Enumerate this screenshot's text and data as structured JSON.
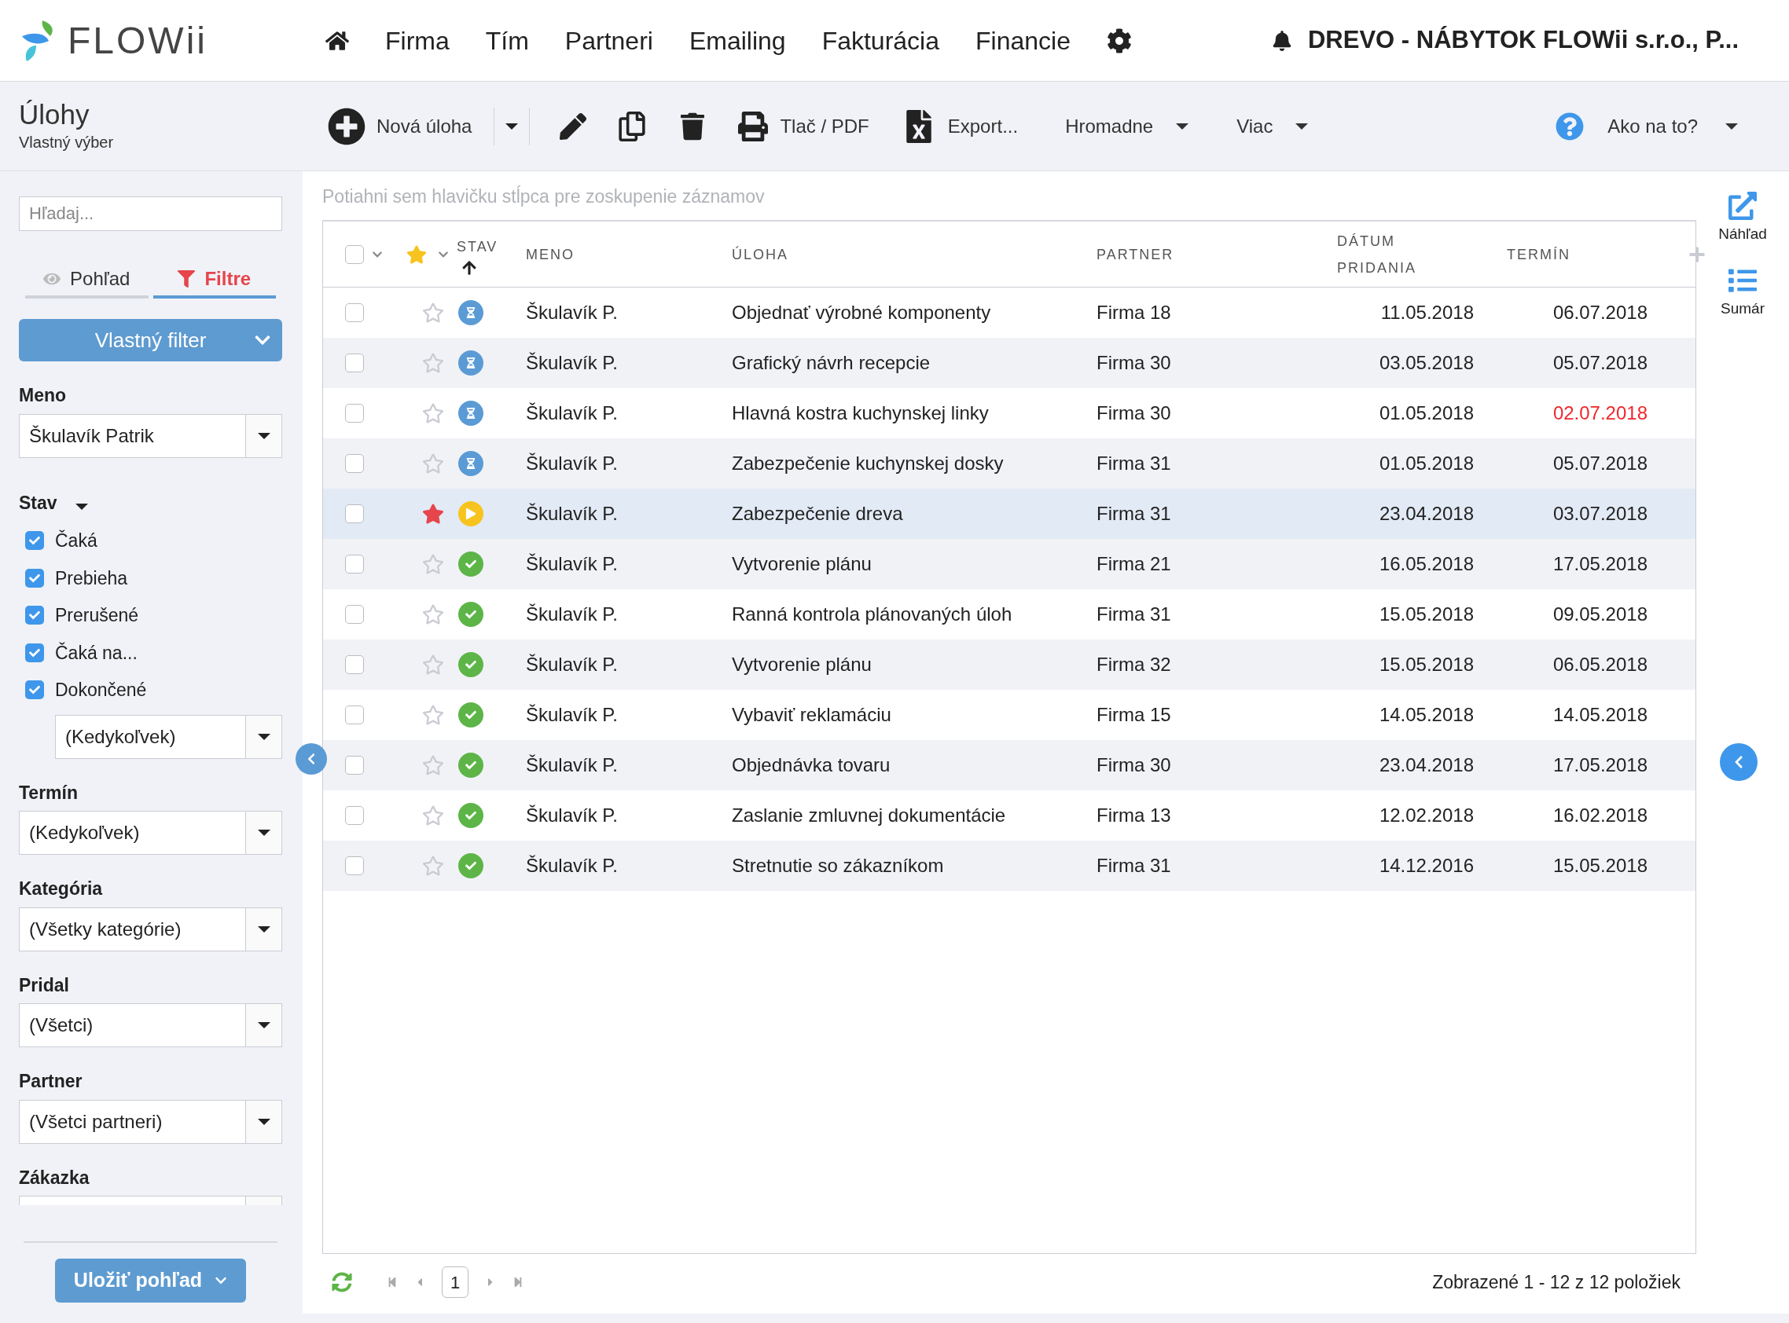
{
  "logo": {
    "text": "FLOWii"
  },
  "nav": [
    "Firma",
    "Tím",
    "Partneri",
    "Emailing",
    "Fakturácia",
    "Financie"
  ],
  "company": "DREVO - NÁBYTOK FLOWii s.r.o., P...",
  "page": {
    "title": "Úlohy",
    "subtitle": "Vlastný výber"
  },
  "toolbar": {
    "new": "Nová úloha",
    "print": "Tlač / PDF",
    "export": "Export...",
    "menus": [
      "Hromadne",
      "Viac"
    ],
    "help": "Ako na to?"
  },
  "sidebar": {
    "search": {
      "placeholder": "Hľadaj..."
    },
    "tabs": [
      {
        "label": "Pohľad",
        "kind": "view",
        "selected": false
      },
      {
        "label": "Filtre",
        "kind": "filter",
        "selected": true
      }
    ],
    "filter_button": "Vlastný filter",
    "filters": [
      {
        "kind": "select",
        "label": "Meno",
        "value": "Škulavík Patrik"
      },
      {
        "kind": "checklist",
        "label": "Stav",
        "items": [
          {
            "label": "Čaká",
            "checked": true
          },
          {
            "label": "Prebieha",
            "checked": true
          },
          {
            "label": "Prerušené",
            "checked": true
          },
          {
            "label": "Čaká na...",
            "checked": true
          },
          {
            "label": "Dokončené",
            "checked": true
          }
        ],
        "value": "(Kedykoľvek)"
      },
      {
        "kind": "select",
        "label": "Termín",
        "value": "(Kedykoľvek)"
      },
      {
        "kind": "select",
        "label": "Kategória",
        "value": "(Všetky kategórie)"
      },
      {
        "kind": "select",
        "label": "Pridal",
        "value": "(Všetci)"
      },
      {
        "kind": "select",
        "label": "Partner",
        "value": "(Všetci partneri)"
      },
      {
        "kind": "select",
        "label": "Zákazka"
      }
    ],
    "save_button": "Uložiť pohľad"
  },
  "grid": {
    "group_hint": "Potiahni sem hlavičku stĺpca pre zoskupenie záznamov",
    "select_all": {
      "checked": false
    },
    "columns": [
      {
        "label": "STAV",
        "sorted_ascending": true
      },
      {
        "label": "MENO"
      },
      {
        "label": "ÚLOHA"
      },
      {
        "label": "PARTNER"
      },
      {
        "label": "DÁTUM PRIDANIA"
      },
      {
        "label": "TERMÍN"
      }
    ],
    "rows": [
      {
        "checked": false,
        "starred": false,
        "selected": false,
        "kind": "waiting",
        "name": "Škulavík P.",
        "task": "Objednať výrobné komponenty",
        "partner": "Firma 18",
        "added": "11.05.2018",
        "due": "06.07.2018",
        "overdue": false
      },
      {
        "checked": false,
        "starred": false,
        "selected": false,
        "kind": "waiting",
        "name": "Škulavík P.",
        "task": "Grafický návrh recepcie",
        "partner": "Firma 30",
        "added": "03.05.2018",
        "due": "05.07.2018",
        "overdue": false
      },
      {
        "checked": false,
        "starred": false,
        "selected": false,
        "kind": "waiting",
        "name": "Škulavík P.",
        "task": "Hlavná kostra kuchynskej linky",
        "partner": "Firma 30",
        "added": "01.05.2018",
        "due": "02.07.2018",
        "overdue": true
      },
      {
        "checked": false,
        "starred": false,
        "selected": false,
        "kind": "waiting",
        "name": "Škulavík P.",
        "task": "Zabezpečenie kuchynskej dosky",
        "partner": "Firma 31",
        "added": "01.05.2018",
        "due": "05.07.2018",
        "overdue": false
      },
      {
        "checked": false,
        "starred": true,
        "selected": true,
        "kind": "in_progress",
        "name": "Škulavík P.",
        "task": "Zabezpečenie dreva",
        "partner": "Firma 31",
        "added": "23.04.2018",
        "due": "03.07.2018",
        "overdue": false
      },
      {
        "checked": false,
        "starred": false,
        "selected": false,
        "kind": "done",
        "name": "Škulavík P.",
        "task": "Vytvorenie plánu",
        "partner": "Firma 21",
        "added": "16.05.2018",
        "due": "17.05.2018",
        "overdue": false
      },
      {
        "checked": false,
        "starred": false,
        "selected": false,
        "kind": "done",
        "name": "Škulavík P.",
        "task": "Ranná kontrola plánovaných úloh",
        "partner": "Firma 31",
        "added": "15.05.2018",
        "due": "09.05.2018",
        "overdue": false
      },
      {
        "checked": false,
        "starred": false,
        "selected": false,
        "kind": "done",
        "name": "Škulavík P.",
        "task": "Vytvorenie plánu",
        "partner": "Firma 32",
        "added": "15.05.2018",
        "due": "06.05.2018",
        "overdue": false
      },
      {
        "checked": false,
        "starred": false,
        "selected": false,
        "kind": "done",
        "name": "Škulavík P.",
        "task": "Vybaviť reklamáciu",
        "partner": "Firma 15",
        "added": "14.05.2018",
        "due": "14.05.2018",
        "overdue": false
      },
      {
        "checked": false,
        "starred": false,
        "selected": false,
        "kind": "done",
        "name": "Škulavík P.",
        "task": "Objednávka tovaru",
        "partner": "Firma 30",
        "added": "23.04.2018",
        "due": "17.05.2018",
        "overdue": false
      },
      {
        "checked": false,
        "starred": false,
        "selected": false,
        "kind": "done",
        "name": "Škulavík P.",
        "task": "Zaslanie zmluvnej dokumentácie",
        "partner": "Firma 13",
        "added": "12.02.2018",
        "due": "16.02.2018",
        "overdue": false
      },
      {
        "checked": false,
        "starred": false,
        "selected": false,
        "kind": "done",
        "name": "Škulavík P.",
        "task": "Stretnutie so zákazníkom",
        "partner": "Firma 31",
        "added": "14.12.2016",
        "due": "15.05.2018",
        "overdue": false
      }
    ]
  },
  "footer": {
    "page": "1",
    "summary": "Zobrazené 1 - 12 z 12 položiek"
  },
  "side_actions": [
    {
      "kind": "preview",
      "label": "Náhľad"
    },
    {
      "kind": "summary",
      "label": "Sumár"
    }
  ]
}
